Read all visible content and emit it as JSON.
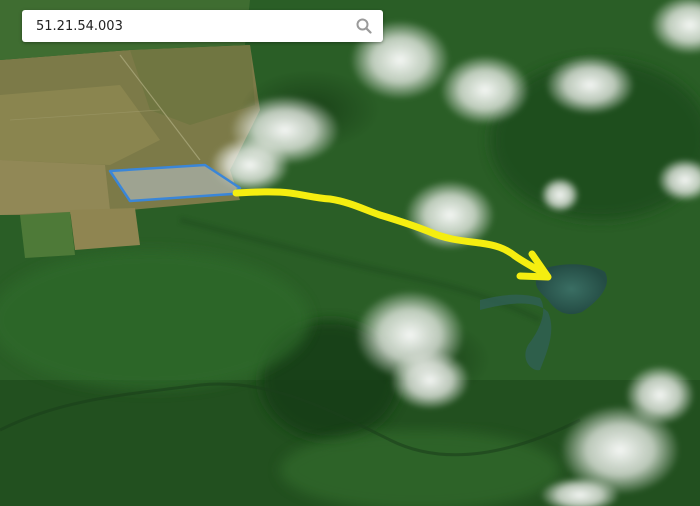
{
  "search": {
    "value": "51.21.54.003",
    "icon": "search-icon"
  },
  "map": {
    "type": "satellite",
    "parcel": {
      "outline_color": "#3a86d8",
      "fill_color": "#9aa6a0"
    },
    "route_arrow": {
      "color": "#f5ee10"
    }
  },
  "colors": {
    "forest_dark": "#1c4a1c",
    "forest_mid": "#2d6428",
    "field": "#8a8452",
    "lake": "#2d5d54",
    "cloud": "#eef0ec"
  }
}
